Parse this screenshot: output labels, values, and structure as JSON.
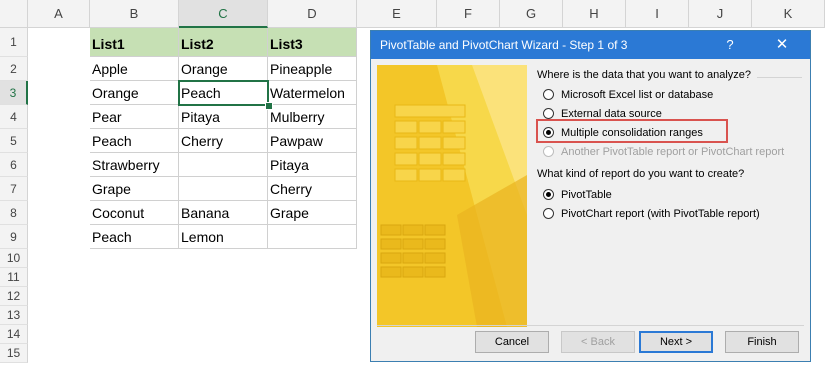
{
  "sheet": {
    "columns": [
      "A",
      "B",
      "C",
      "D",
      "E",
      "F",
      "G",
      "H",
      "I",
      "J",
      "K"
    ],
    "rows": [
      "1",
      "2",
      "3",
      "4",
      "5",
      "6",
      "7",
      "8",
      "9",
      "10",
      "11",
      "12",
      "13",
      "14",
      "15"
    ],
    "headers": [
      "List1",
      "List2",
      "List3"
    ],
    "data": [
      [
        "Apple",
        "Orange",
        "Pineapple"
      ],
      [
        "Orange",
        "Peach",
        "Watermelon"
      ],
      [
        "Pear",
        "Pitaya",
        "Mulberry"
      ],
      [
        "Peach",
        "Cherry",
        "Pawpaw"
      ],
      [
        "Strawberry",
        "",
        "Pitaya"
      ],
      [
        "Grape",
        "",
        "Cherry"
      ],
      [
        "Coconut",
        "Banana",
        "Grape"
      ],
      [
        "Peach",
        "Lemon",
        ""
      ]
    ],
    "colors": {
      "header_fill": "#c6e0b4",
      "active": "#217346"
    }
  },
  "dialog": {
    "title": "PivotTable and PivotChart Wizard - Step 1 of 3",
    "help": "?",
    "close": "✕",
    "q1": "Where is the data that you want to analyze?",
    "opt1": "Microsoft Excel list or database",
    "opt2": "External data source",
    "opt3": "Multiple consolidation ranges",
    "opt4": "Another PivotTable report or PivotChart report",
    "q2": "What kind of report do you want to create?",
    "opt5": "PivotTable",
    "opt6": "PivotChart report (with PivotTable report)",
    "cancel": "Cancel",
    "back": "< Back",
    "next": "Next >",
    "finish": "Finish",
    "colors": {
      "titlebar": "#2b79d5",
      "art": "#f3c628",
      "highlight": "#d9534f"
    }
  }
}
